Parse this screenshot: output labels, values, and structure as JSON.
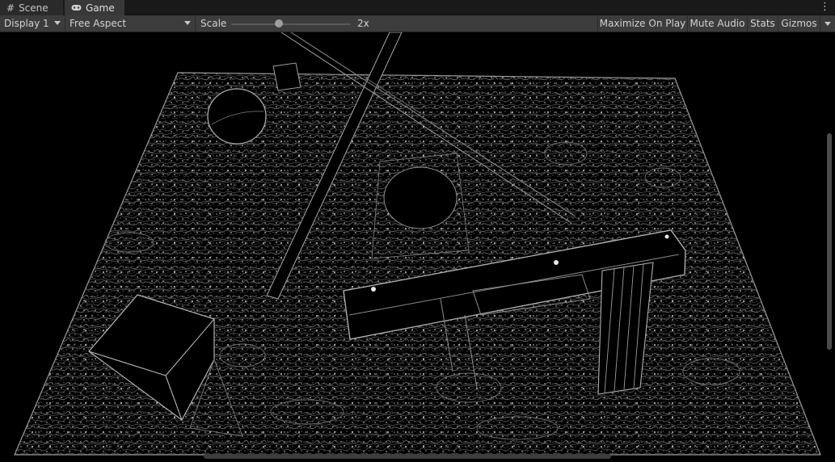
{
  "tabs": [
    {
      "label": "Scene",
      "icon": "grid-icon",
      "active": false
    },
    {
      "label": "Game",
      "icon": "gamepad-icon",
      "active": true
    }
  ],
  "toolbar": {
    "display": "Display 1",
    "aspect": "Free Aspect",
    "scale_label": "Scale",
    "scale_value": "2x",
    "scale_slider_fraction": 0.4,
    "maximize_label": "Maximize On Play",
    "mute_label": "Mute Audio",
    "stats_label": "Stats",
    "gizmos_label": "Gizmos"
  },
  "colors": {
    "background": "#000000",
    "toolbar": "#3c3c3c",
    "tabbar": "#191919",
    "edge_lines": "#8a8a8a"
  }
}
